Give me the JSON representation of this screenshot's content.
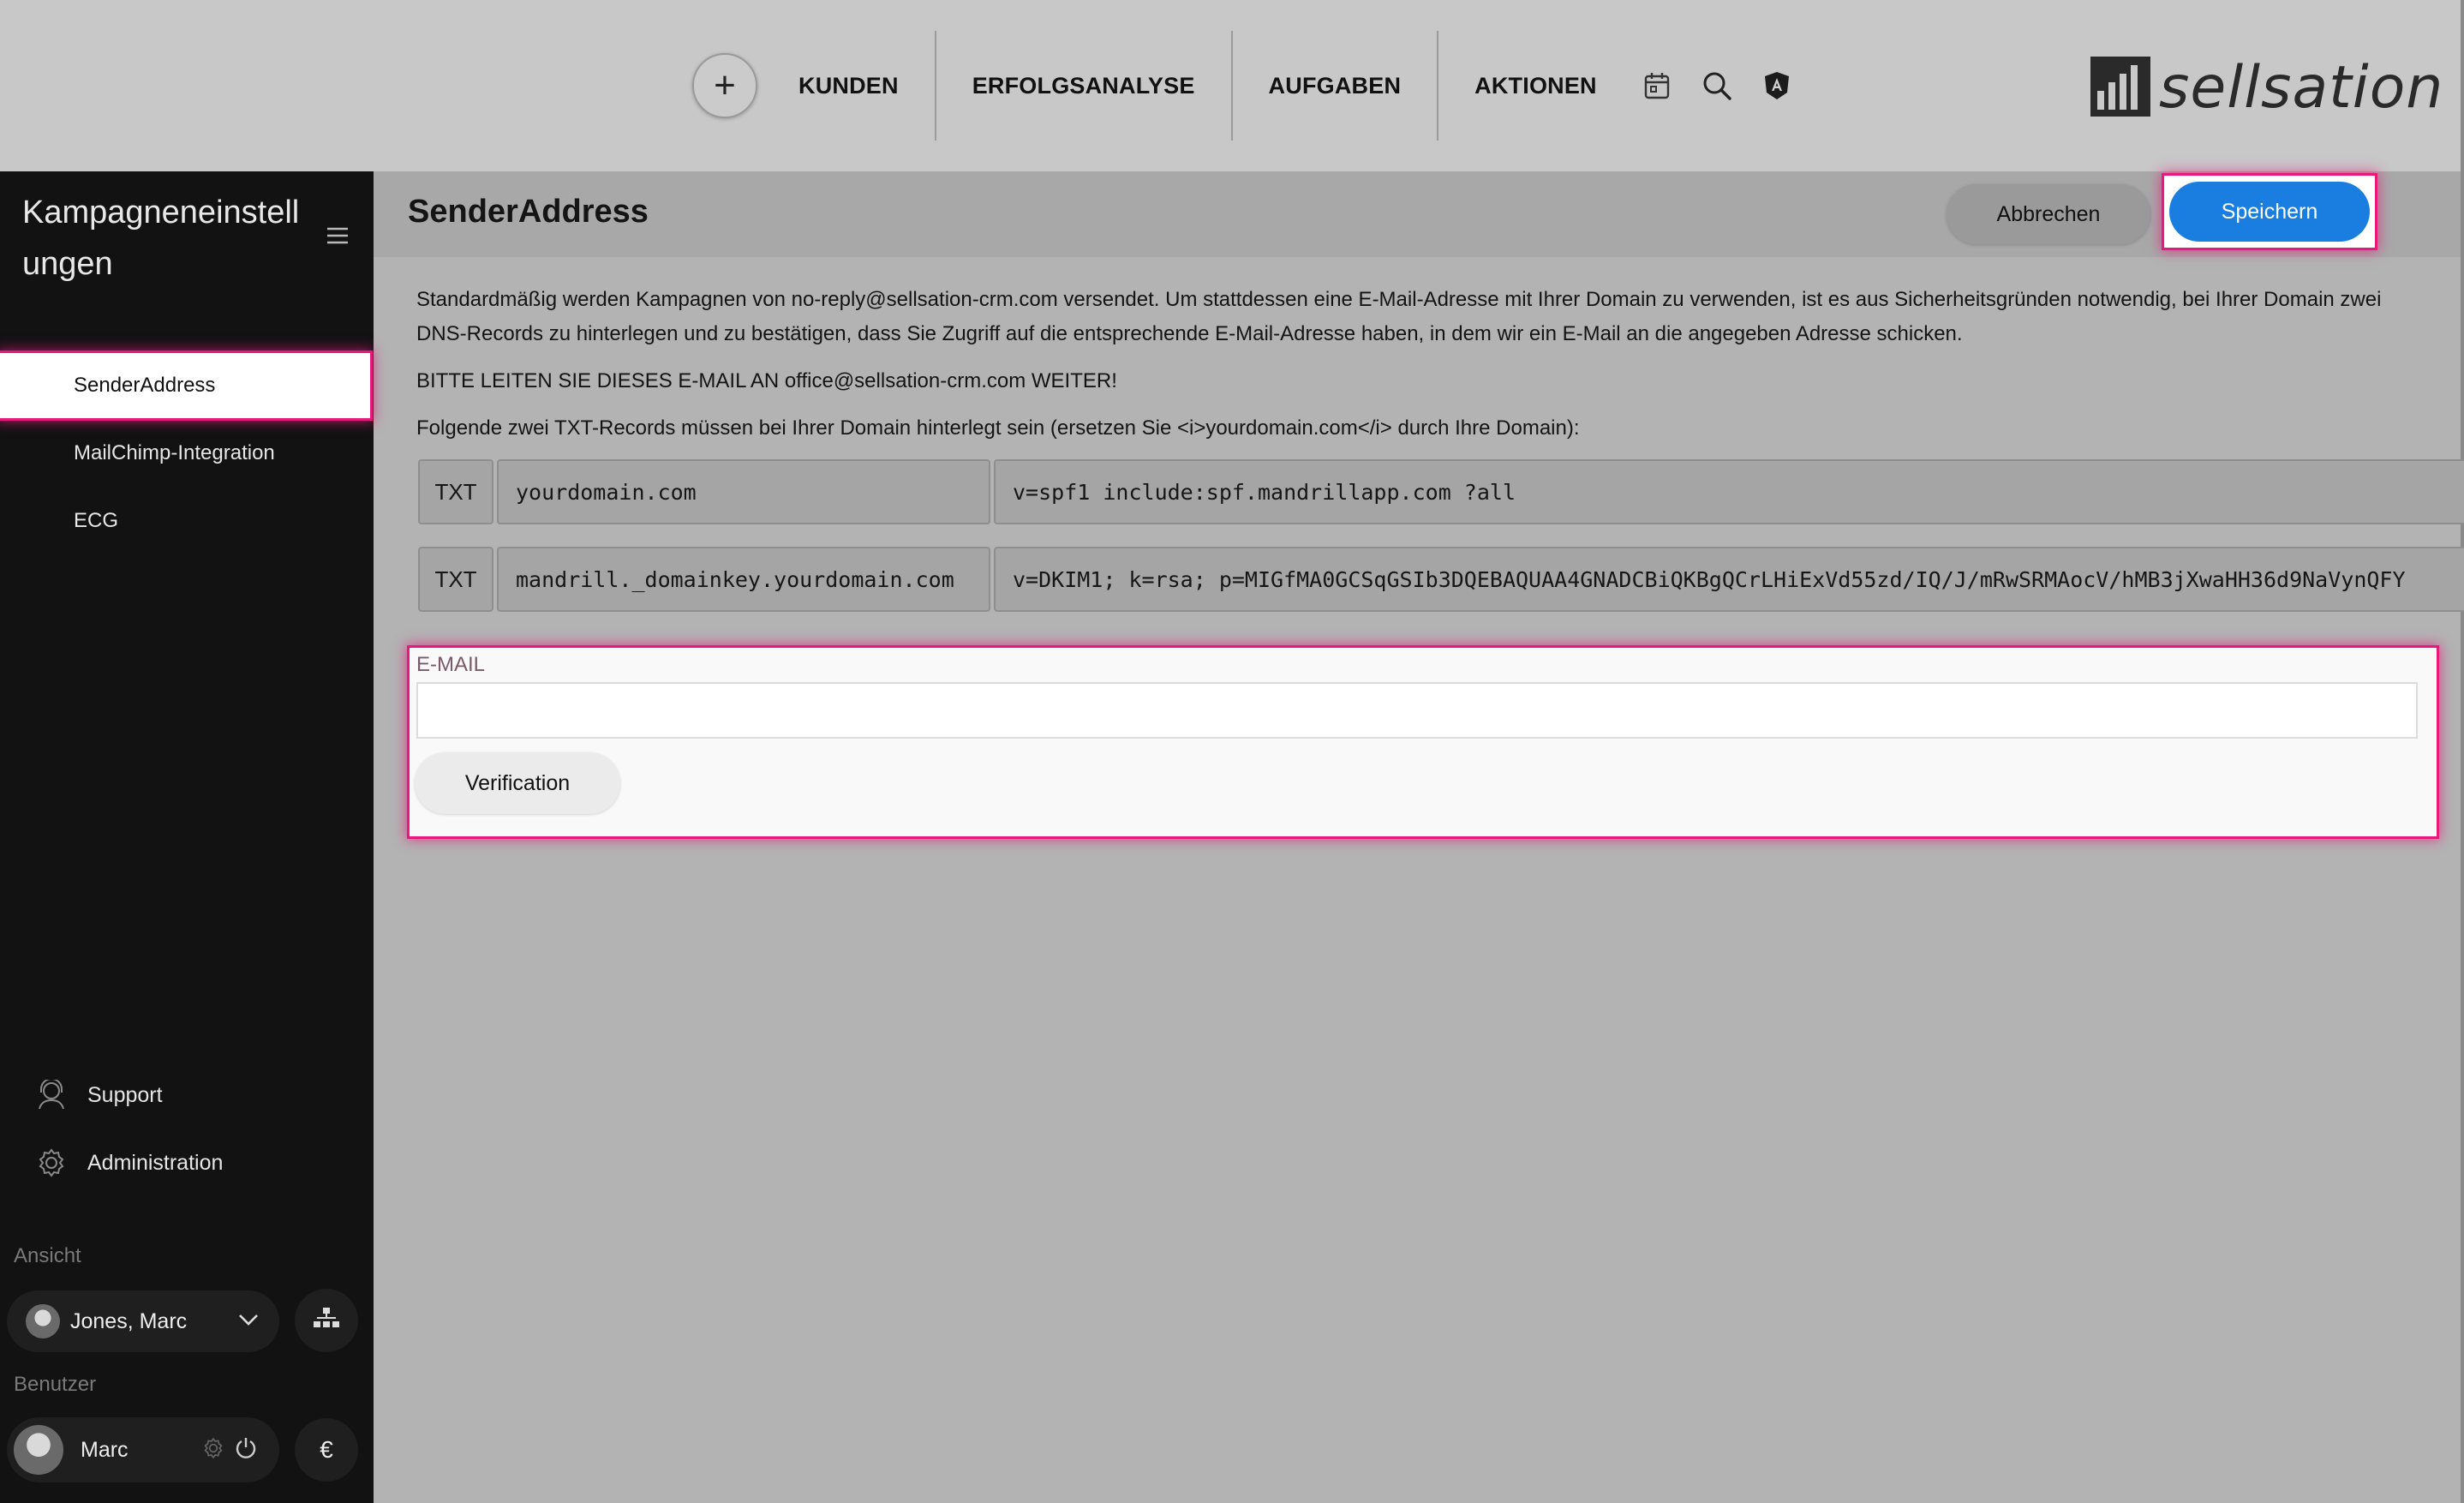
{
  "topnav": {
    "items": [
      "KUNDEN",
      "ERFOLGSANALYSE",
      "AUFGABEN",
      "AKTIONEN"
    ],
    "add_icon": "plus-icon",
    "icons": [
      "calendar-icon",
      "search-icon",
      "angular-shield-icon"
    ]
  },
  "brand": {
    "logo_text": "sellsation"
  },
  "sidebar": {
    "title": "Kampagneneinstellungen",
    "items": [
      {
        "label": "SenderAddress",
        "active": true
      },
      {
        "label": "MailChimp-Integration",
        "active": false
      },
      {
        "label": "ECG",
        "active": false
      }
    ],
    "links": [
      {
        "label": "Support",
        "icon": "headset-icon"
      },
      {
        "label": "Administration",
        "icon": "gear-icon"
      }
    ],
    "view_caption": "Ansicht",
    "view_user": "Jones, Marc",
    "user_caption": "Benutzer",
    "user_name": "Marc",
    "currency_symbol": "€"
  },
  "main": {
    "title": "SenderAddress",
    "cancel_label": "Abbrechen",
    "save_label": "Speichern",
    "intro": "Standardmäßig werden Kampagnen von no-reply@sellsation-crm.com versendet. Um stattdessen eine E-Mail-Adresse mit Ihrer Domain zu verwenden, ist es aus Sicherheitsgründen notwendig, bei Ihrer Domain zwei DNS-Records zu hinterlegen und zu bestätigen, dass Sie Zugriff auf die entsprechende E-Mail-Adresse haben, in dem wir ein E-Mail an die angegeben Adresse schicken.",
    "forward_notice": "BITTE LEITEN SIE DIESES E-MAIL AN office@sellsation-crm.com WEITER!",
    "records_intro": "Folgende zwei TXT-Records müssen bei Ihrer Domain hinterlegt sein (ersetzen Sie <i>yourdomain.com</i> durch Ihre Domain):",
    "records": [
      {
        "type": "TXT",
        "host": "yourdomain.com",
        "value": "v=spf1 include:spf.mandrillapp.com ?all"
      },
      {
        "type": "TXT",
        "host": "mandrill._domainkey.yourdomain.com",
        "value": "v=DKIM1; k=rsa; p=MIGfMA0GCSqGSIb3DQEBAQUAA4GNADCBiQKBgQCrLHiExVd55zd/IQ/J/mRwSRMAocV/hMB3jXwaHH36d9NaVynQFY"
      }
    ],
    "email_label": "E-MAIL",
    "email_value": "",
    "verify_label": "Verification"
  },
  "colors": {
    "accent": "#1a7ee0",
    "highlight": "#e8197d",
    "sidebar_bg": "#121212"
  }
}
